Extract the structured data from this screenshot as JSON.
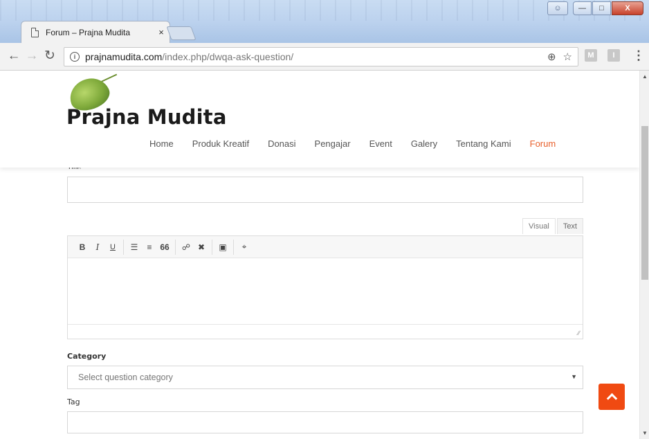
{
  "browser": {
    "tab_title": "Forum – Prajna Mudita",
    "tab_close": "×",
    "url_host": "prajnamudita.com",
    "url_path": "/index.php/dwqa-ask-question/",
    "extensions": [
      "M",
      "I"
    ]
  },
  "window_controls": {
    "minimize": "—",
    "maximize": "□",
    "close": "X"
  },
  "site": {
    "logo_text": "Prajna Mudita",
    "nav": [
      {
        "label": "Home"
      },
      {
        "label": "Produk Kreatif"
      },
      {
        "label": "Donasi"
      },
      {
        "label": "Pengajar"
      },
      {
        "label": "Event"
      },
      {
        "label": "Galery"
      },
      {
        "label": "Tentang Kami"
      },
      {
        "label": "Forum",
        "active": true
      }
    ],
    "accent_color": "#e8602c"
  },
  "form": {
    "title_label": "Title",
    "title_value": "",
    "editor_tabs": {
      "visual": "Visual",
      "text": "Text"
    },
    "toolbar": {
      "bold": "B",
      "italic": "I",
      "underline": "U",
      "quote": "66"
    },
    "category_label": "Category",
    "category_placeholder": "Select question category",
    "tag_label": "Tag",
    "tag_value": ""
  }
}
